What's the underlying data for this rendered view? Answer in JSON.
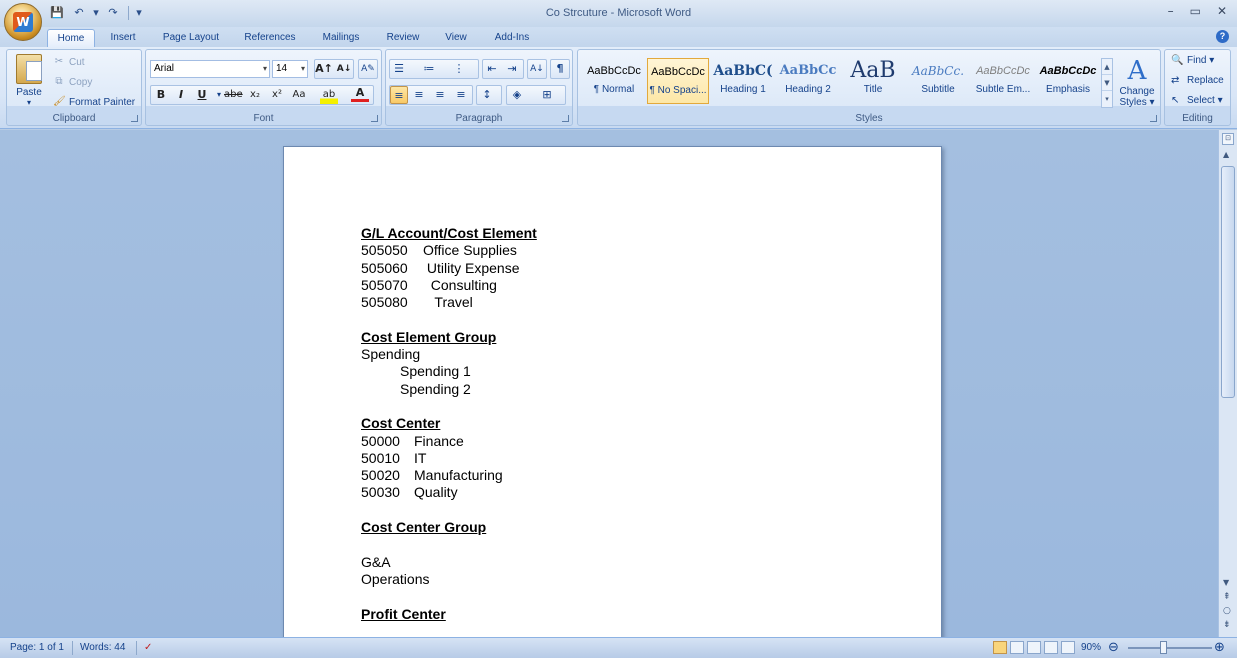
{
  "window": {
    "title": "Co Strcuture - Microsoft Word",
    "controls": [
      "–",
      "▭",
      "✕"
    ]
  },
  "qat": {
    "save": "💾",
    "undo": "↶",
    "undo_arrow": "▾",
    "redo": "↷",
    "customize": "▾"
  },
  "office_button": {
    "logo": "W"
  },
  "tabs": [
    "Home",
    "Insert",
    "Page Layout",
    "References",
    "Mailings",
    "Review",
    "View",
    "Add-Ins"
  ],
  "ribbon": {
    "clipboard": {
      "label": "Clipboard",
      "paste": "Paste",
      "paste_arrow": "▾",
      "cut": "Cut",
      "copy": "Copy",
      "format_painter": "Format Painter"
    },
    "font": {
      "label": "Font",
      "font_name": "Arial",
      "font_size": "14",
      "grow": "A↑",
      "shrink": "A↓",
      "clear": "A✎",
      "bold": "B",
      "italic": "I",
      "underline": "U",
      "strike": "abe",
      "subscript": "x₂",
      "superscript": "x²",
      "change_case": "Aa",
      "highlight": "ab",
      "font_color": "A"
    },
    "paragraph": {
      "label": "Paragraph",
      "bullets": "☰",
      "numbering": "≔",
      "multilevel": "⋮",
      "decrease_indent": "⇤",
      "increase_indent": "⇥",
      "sort": "A↓",
      "show_marks": "¶",
      "align_left": "≡",
      "center": "≡",
      "align_right": "≡",
      "justify": "≡",
      "line_spacing": "↕",
      "shading": "◈",
      "borders": "⊞"
    },
    "styles": {
      "label": "Styles",
      "items": [
        {
          "sample": "AaBbCcDc",
          "name": "¶ Normal"
        },
        {
          "sample": "AaBbCcDc",
          "name": "¶ No Spaci..."
        },
        {
          "sample": "AaBbC(",
          "name": "Heading 1"
        },
        {
          "sample": "AaBbCc",
          "name": "Heading 2"
        },
        {
          "sample": "AaB",
          "name": "Title"
        },
        {
          "sample": "AaBbCc.",
          "name": "Subtitle"
        },
        {
          "sample": "AaBbCcDc",
          "name": "Subtle Em..."
        },
        {
          "sample": "AaBbCcDc",
          "name": "Emphasis"
        }
      ],
      "change_styles_icon": "A",
      "change_styles_line1": "Change",
      "change_styles_line2": "Styles ▾"
    },
    "editing": {
      "label": "Editing",
      "find": "Find ▾",
      "replace": "Replace",
      "select": "Select ▾"
    }
  },
  "document": {
    "lines": [
      {
        "type": "heading",
        "text": "G/L Account/Cost Element"
      },
      {
        "type": "code",
        "code": "505050",
        "text": "Office Supplies"
      },
      {
        "type": "code",
        "code": "505060",
        "text": " Utility Expense"
      },
      {
        "type": "code",
        "code": "505070",
        "text": "  Consulting"
      },
      {
        "type": "code",
        "code": "505080",
        "text": "   Travel"
      },
      {
        "type": "blank",
        "text": ""
      },
      {
        "type": "heading",
        "text": "Cost Element Group"
      },
      {
        "type": "plain",
        "text": "Spending"
      },
      {
        "type": "indent",
        "text": "Spending 1"
      },
      {
        "type": "indent",
        "text": "Spending 2"
      },
      {
        "type": "blank",
        "text": ""
      },
      {
        "type": "heading",
        "text": "Cost Center"
      },
      {
        "type": "code2",
        "code": "50000",
        "text": "Finance"
      },
      {
        "type": "code2",
        "code": "50010",
        "text": "IT"
      },
      {
        "type": "code2",
        "code": "50020",
        "text": "Manufacturing"
      },
      {
        "type": "code2",
        "code": "50030",
        "text": "Quality"
      },
      {
        "type": "blank",
        "text": ""
      },
      {
        "type": "heading",
        "text": "Cost Center Group"
      },
      {
        "type": "blank",
        "text": ""
      },
      {
        "type": "plain",
        "text": "G&A"
      },
      {
        "type": "plain",
        "text": "Operations"
      },
      {
        "type": "blank",
        "text": ""
      },
      {
        "type": "heading",
        "text": "Profit Center"
      }
    ]
  },
  "statusbar": {
    "page": "Page: 1 of 1",
    "words": "Words: 44",
    "proofing_icon": "✓",
    "zoom": "90%",
    "zoom_out": "⊖",
    "zoom_in": "⊕"
  },
  "colors": {
    "ribbon_text": "#15428b",
    "doc_background": "#a4bfe0",
    "selected_style": "#fde7a6"
  }
}
